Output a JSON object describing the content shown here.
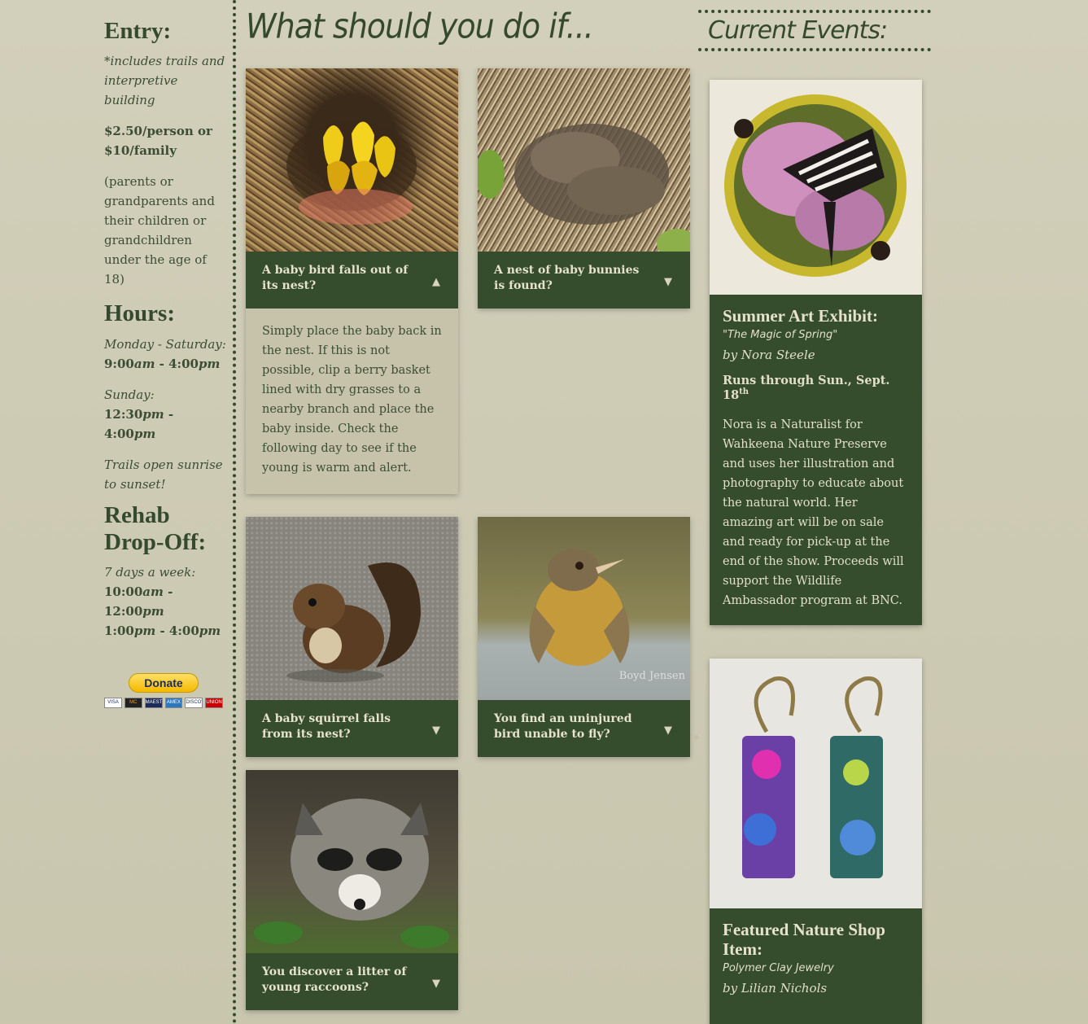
{
  "sidebar": {
    "entry": {
      "heading": "Entry:",
      "note": "*includes trails and interpretive building",
      "price": "$2.50/person or $10/family",
      "detail": "(parents or grandparents and their children or grandchildren under the age of 18)"
    },
    "hours": {
      "heading": "Hours:",
      "weekday_label": "Monday - Saturday:",
      "weekday_start": "9:00",
      "weekday_start_period": "am",
      "weekday_end": "4:00",
      "weekday_end_period": "pm",
      "sunday_label": "Sunday:",
      "sunday_start": "12:30",
      "sunday_start_period": "pm",
      "sunday_end": "4:00",
      "sunday_end_period": "pm",
      "trails_note": "Trails open sunrise to sunset!"
    },
    "rehab": {
      "heading": "Rehab Drop-Off:",
      "days": "7 days a week:",
      "slot1_start": "10:00",
      "slot1_start_period": "am",
      "slot1_end": "12:00",
      "slot1_end_period": "pm",
      "slot2_start": "1:00",
      "slot2_start_period": "pm",
      "slot2_end": "4:00",
      "slot2_end_period": "pm"
    },
    "donate": {
      "label": "Donate",
      "cards": [
        "VISA",
        "MC",
        "MAESTRO",
        "AMEX",
        "DISCOVER",
        "UNION"
      ]
    }
  },
  "main": {
    "title": "What should you do if...",
    "tiles": [
      {
        "question": "A baby bird falls out of its nest?",
        "arrow": "▲",
        "answer": "Simply place the baby back in the nest. If this is not possible, clip a berry basket lined with dry grasses to a nearby branch and place the baby inside. Check the following day to see if the young is warm and alert."
      },
      {
        "question": "A nest of baby bunnies is found?",
        "arrow": "▼"
      },
      {
        "question": "A baby squirrel falls from its nest?",
        "arrow": "▼"
      },
      {
        "question": "You find an uninjured bird unable to fly?",
        "arrow": "▼",
        "watermark": "Boyd Jensen"
      },
      {
        "question": "You discover a litter of young raccoons?",
        "arrow": "▼"
      }
    ]
  },
  "events": {
    "title": "Current Events:",
    "items": [
      {
        "heading": "Summer Art Exhibit:",
        "subtitle": "\"The Magic of Spring\"",
        "by": "by Nora Steele",
        "runs_prefix": "Runs through Sun., Sept. 18",
        "runs_sup": "th",
        "description": "Nora is a Naturalist for Wahkeena Nature Preserve and uses her illustration and photography to educate about the natural world. Her amazing art will be on sale and ready for pick-up at the end of the show. Proceeds will support the Wildlife Ambassador program at BNC."
      },
      {
        "heading": "Featured Nature Shop Item:",
        "subtitle": "Polymer Clay Jewelry",
        "by": "by Lilian Nichols"
      }
    ]
  },
  "colors": {
    "dark_green": "#354d2d",
    "paper": "#cfcbb4",
    "tile_light": "#c7c3ab"
  }
}
